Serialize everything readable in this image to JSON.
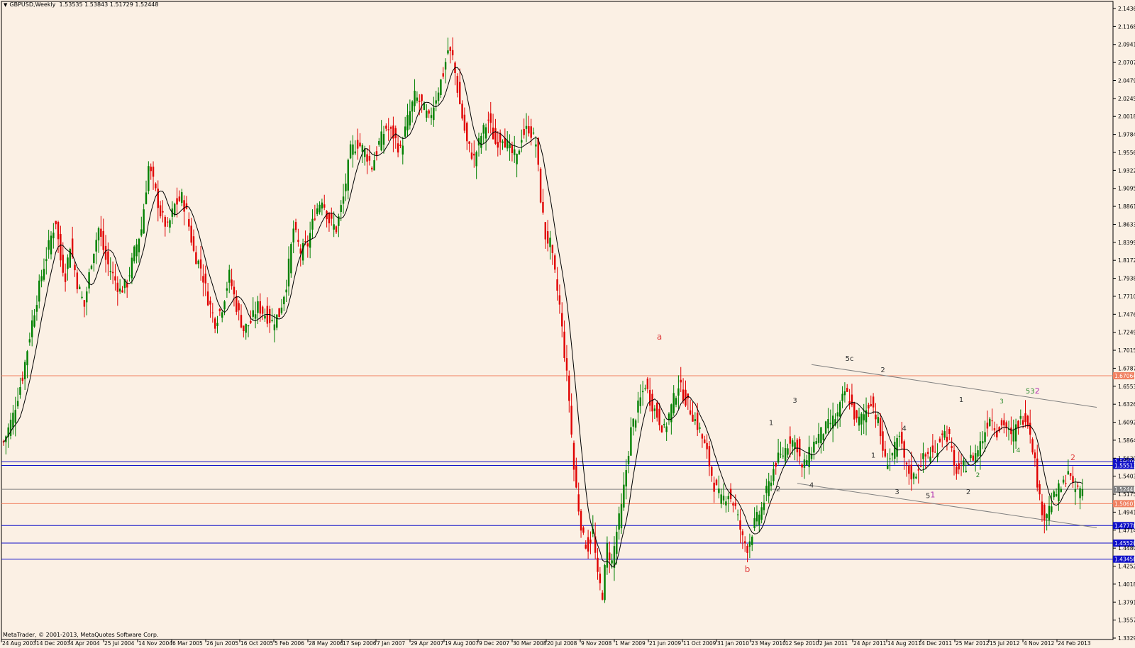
{
  "header": {
    "symbol": "GBPUSD,Weekly",
    "ohlc": "1.53535 1.53843 1.51729 1.52448"
  },
  "footer": {
    "copyright": "MetaTrader, © 2001-2013, MetaQuotes Software Corp."
  },
  "colors": {
    "background": "#fbf0e4",
    "frame": "#000000",
    "bull_candle": "#008000",
    "bear_candle": "#e00000",
    "moving_average": "#000000",
    "red_level": "#f08060",
    "blue_level": "#1010c8",
    "gray_level": "#808080",
    "trendline": "#808080",
    "wave_red": "#e04040",
    "wave_dark": "#303030",
    "wave_green": "#2e8b2e",
    "wave_magenta": "#b030b0"
  },
  "chart_data": {
    "type": "candlestick",
    "title": "GBPUSD,Weekly",
    "ylim": [
      1.3329,
      2.1435
    ],
    "y_ticks": [
      "2.14365",
      "2.11685",
      "2.09410",
      "2.07070",
      "2.04795",
      "2.02455",
      "2.00180",
      "1.97840",
      "1.95565",
      "1.93225",
      "1.90950",
      "1.88610",
      "1.86335",
      "1.83995",
      "1.81720",
      "1.79380",
      "1.77105",
      "1.74765",
      "1.72490",
      "1.70150",
      "1.67875",
      "1.65535",
      "1.63260",
      "1.60920",
      "1.58645",
      "1.56305",
      "1.54030",
      "1.51755",
      "1.49415",
      "1.47140",
      "1.44800",
      "1.42525",
      "1.40185",
      "1.37910",
      "1.35570",
      "1.33295"
    ],
    "x_ticks": [
      "24 Aug 2003",
      "14 Dec 2003",
      "4 Apr 2004",
      "25 Jul 2004",
      "14 Nov 2004",
      "6 Mar 2005",
      "26 Jun 2005",
      "16 Oct 2005",
      "5 Feb 2006",
      "28 May 2006",
      "17 Sep 2006",
      "7 Jan 2007",
      "29 Apr 2007",
      "19 Aug 2007",
      "9 Dec 2007",
      "30 Mar 2008",
      "20 Jul 2008",
      "9 Nov 2008",
      "1 Mar 2009",
      "21 Jun 2009",
      "11 Oct 2009",
      "31 Jan 2010",
      "23 May 2010",
      "12 Sep 2010",
      "2 Jan 2011",
      "24 Apr 2011",
      "14 Aug 2011",
      "4 Dec 2011",
      "25 Mar 2012",
      "15 Jul 2012",
      "4 Nov 2012",
      "24 Feb 2013"
    ],
    "close_path": [
      [
        0,
        1.585
      ],
      [
        4,
        1.62
      ],
      [
        8,
        1.67
      ],
      [
        12,
        1.74
      ],
      [
        16,
        1.8
      ],
      [
        20,
        1.85
      ],
      [
        22,
        1.87
      ],
      [
        24,
        1.82
      ],
      [
        26,
        1.8
      ],
      [
        28,
        1.84
      ],
      [
        31,
        1.79
      ],
      [
        34,
        1.76
      ],
      [
        37,
        1.82
      ],
      [
        40,
        1.86
      ],
      [
        43,
        1.82
      ],
      [
        46,
        1.8
      ],
      [
        49,
        1.78
      ],
      [
        52,
        1.79
      ],
      [
        55,
        1.83
      ],
      [
        58,
        1.86
      ],
      [
        61,
        1.94
      ],
      [
        63,
        1.92
      ],
      [
        66,
        1.88
      ],
      [
        69,
        1.86
      ],
      [
        72,
        1.89
      ],
      [
        75,
        1.9
      ],
      [
        77,
        1.88
      ],
      [
        80,
        1.83
      ],
      [
        83,
        1.81
      ],
      [
        86,
        1.77
      ],
      [
        89,
        1.74
      ],
      [
        92,
        1.76
      ],
      [
        95,
        1.8
      ],
      [
        98,
        1.76
      ],
      [
        101,
        1.73
      ],
      [
        104,
        1.74
      ],
      [
        107,
        1.76
      ],
      [
        110,
        1.75
      ],
      [
        113,
        1.74
      ],
      [
        116,
        1.75
      ],
      [
        119,
        1.79
      ],
      [
        122,
        1.86
      ],
      [
        125,
        1.83
      ],
      [
        128,
        1.84
      ],
      [
        131,
        1.88
      ],
      [
        134,
        1.9
      ],
      [
        137,
        1.87
      ],
      [
        140,
        1.86
      ],
      [
        143,
        1.9
      ],
      [
        146,
        1.96
      ],
      [
        149,
        1.97
      ],
      [
        152,
        1.96
      ],
      [
        155,
        1.94
      ],
      [
        158,
        1.97
      ],
      [
        161,
        1.99
      ],
      [
        164,
        1.98
      ],
      [
        167,
        1.96
      ],
      [
        170,
        2.0
      ],
      [
        173,
        2.03
      ],
      [
        176,
        2.02
      ],
      [
        179,
        2.0
      ],
      [
        182,
        2.03
      ],
      [
        185,
        2.06
      ],
      [
        187,
        2.09
      ],
      [
        189,
        2.08
      ],
      [
        192,
        2.02
      ],
      [
        195,
        1.97
      ],
      [
        198,
        1.95
      ],
      [
        201,
        1.98
      ],
      [
        204,
        2.0
      ],
      [
        207,
        1.97
      ],
      [
        210,
        1.98
      ],
      [
        213,
        1.96
      ],
      [
        216,
        1.95
      ],
      [
        218,
        1.98
      ],
      [
        221,
        1.99
      ],
      [
        224,
        1.97
      ],
      [
        226,
        1.9
      ],
      [
        228,
        1.85
      ],
      [
        230,
        1.84
      ],
      [
        232,
        1.8
      ],
      [
        234,
        1.76
      ],
      [
        236,
        1.7
      ],
      [
        238,
        1.64
      ],
      [
        240,
        1.55
      ],
      [
        242,
        1.5
      ],
      [
        244,
        1.46
      ],
      [
        246,
        1.45
      ],
      [
        248,
        1.47
      ],
      [
        250,
        1.41
      ],
      [
        252,
        1.39
      ],
      [
        254,
        1.45
      ],
      [
        256,
        1.43
      ],
      [
        258,
        1.47
      ],
      [
        260,
        1.5
      ],
      [
        262,
        1.55
      ],
      [
        264,
        1.6
      ],
      [
        266,
        1.62
      ],
      [
        268,
        1.64
      ],
      [
        270,
        1.66
      ],
      [
        272,
        1.64
      ],
      [
        275,
        1.62
      ],
      [
        278,
        1.6
      ],
      [
        281,
        1.63
      ],
      [
        284,
        1.66
      ],
      [
        287,
        1.64
      ],
      [
        290,
        1.62
      ],
      [
        293,
        1.6
      ],
      [
        296,
        1.57
      ],
      [
        299,
        1.53
      ],
      [
        302,
        1.51
      ],
      [
        305,
        1.52
      ],
      [
        308,
        1.5
      ],
      [
        311,
        1.46
      ],
      [
        313,
        1.45
      ],
      [
        316,
        1.48
      ],
      [
        319,
        1.5
      ],
      [
        322,
        1.53
      ],
      [
        325,
        1.56
      ],
      [
        328,
        1.57
      ],
      [
        331,
        1.59
      ],
      [
        334,
        1.58
      ],
      [
        336,
        1.55
      ],
      [
        339,
        1.57
      ],
      [
        342,
        1.59
      ],
      [
        345,
        1.6
      ],
      [
        348,
        1.61
      ],
      [
        351,
        1.62
      ],
      [
        354,
        1.65
      ],
      [
        356,
        1.64
      ],
      [
        359,
        1.61
      ],
      [
        362,
        1.62
      ],
      [
        365,
        1.64
      ],
      [
        368,
        1.61
      ],
      [
        371,
        1.56
      ],
      [
        374,
        1.57
      ],
      [
        377,
        1.59
      ],
      [
        380,
        1.55
      ],
      [
        383,
        1.54
      ],
      [
        386,
        1.56
      ],
      [
        389,
        1.57
      ],
      [
        392,
        1.57
      ],
      [
        395,
        1.6
      ],
      [
        398,
        1.59
      ],
      [
        400,
        1.55
      ],
      [
        403,
        1.55
      ],
      [
        406,
        1.56
      ],
      [
        409,
        1.57
      ],
      [
        412,
        1.59
      ],
      [
        415,
        1.62
      ],
      [
        418,
        1.6
      ],
      [
        421,
        1.61
      ],
      [
        424,
        1.59
      ],
      [
        427,
        1.61
      ],
      [
        430,
        1.62
      ],
      [
        432,
        1.6
      ],
      [
        434,
        1.56
      ],
      [
        436,
        1.51
      ],
      [
        438,
        1.49
      ],
      [
        440,
        1.5
      ],
      [
        443,
        1.52
      ],
      [
        446,
        1.53
      ],
      [
        448,
        1.55
      ],
      [
        450,
        1.524
      ]
    ],
    "horizontal_levels": [
      {
        "value": 1.67064,
        "label": "1.67064",
        "color": "red"
      },
      {
        "value": 1.56,
        "label": "1.56000",
        "color": "blue"
      },
      {
        "value": 1.55513,
        "label": "1.55513",
        "color": "blue"
      },
      {
        "value": 1.52448,
        "label": "1.52448",
        "color": "gray"
      },
      {
        "value": 1.50601,
        "label": "1.50601",
        "color": "red"
      },
      {
        "value": 1.47778,
        "label": "1.47778",
        "color": "blue"
      },
      {
        "value": 1.4552,
        "label": "1.45520",
        "color": "blue"
      },
      {
        "value": 1.4345,
        "label": "1.43450",
        "color": "blue"
      }
    ],
    "trendlines": [
      {
        "from": [
          340,
          1.685
        ],
        "to": [
          460,
          1.63
        ]
      },
      {
        "from": [
          334,
          1.532
        ],
        "to": [
          460,
          1.475
        ]
      }
    ],
    "wave_labels": [
      {
        "text": "a",
        "bar": 276,
        "value": 1.717,
        "color": "red",
        "size": 12
      },
      {
        "text": "b",
        "bar": 313,
        "value": 1.418,
        "color": "red",
        "size": 12
      },
      {
        "text": "5c",
        "bar": 356,
        "value": 1.69,
        "color": "dark",
        "size": 10
      },
      {
        "text": "2",
        "bar": 370,
        "value": 1.675,
        "color": "dark",
        "size": 10
      },
      {
        "text": "1",
        "bar": 323,
        "value": 1.607,
        "color": "dark",
        "size": 10
      },
      {
        "text": "2",
        "bar": 326,
        "value": 1.522,
        "color": "dark",
        "size": 10
      },
      {
        "text": "3",
        "bar": 333,
        "value": 1.636,
        "color": "dark",
        "size": 10
      },
      {
        "text": "4",
        "bar": 340,
        "value": 1.527,
        "color": "dark",
        "size": 10
      },
      {
        "text": "1",
        "bar": 366,
        "value": 1.565,
        "color": "dark",
        "size": 10
      },
      {
        "text": "3",
        "bar": 376,
        "value": 1.518,
        "color": "dark",
        "size": 10
      },
      {
        "text": "4",
        "bar": 379,
        "value": 1.6,
        "color": "dark",
        "size": 10
      },
      {
        "text": "5",
        "bar": 389,
        "value": 1.513,
        "color": "dark",
        "size": 10
      },
      {
        "text": "1",
        "bar": 391,
        "value": 1.514,
        "color": "magenta",
        "size": 11
      },
      {
        "text": "1",
        "bar": 403,
        "value": 1.637,
        "color": "dark",
        "size": 10
      },
      {
        "text": "2",
        "bar": 406,
        "value": 1.518,
        "color": "dark",
        "size": 10
      },
      {
        "text": "3",
        "bar": 420,
        "value": 1.635,
        "color": "green",
        "size": 9
      },
      {
        "text": "4",
        "bar": 427,
        "value": 1.572,
        "color": "green",
        "size": 9
      },
      {
        "text": "53",
        "bar": 432,
        "value": 1.648,
        "color": "green",
        "size": 10
      },
      {
        "text": "2",
        "bar": 435,
        "value": 1.648,
        "color": "magenta",
        "size": 11
      },
      {
        "text": "2",
        "bar": 450,
        "value": 1.562,
        "color": "red",
        "size": 11
      },
      {
        "text": "2",
        "bar": 410,
        "value": 1.54,
        "color": "green",
        "size": 9
      }
    ]
  }
}
